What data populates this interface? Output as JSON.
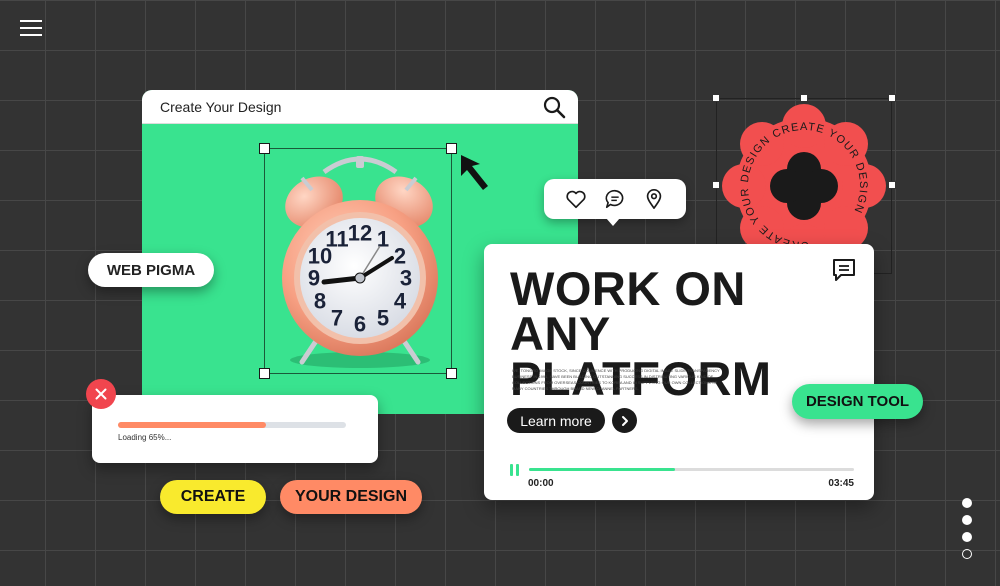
{
  "design_window": {
    "title": "Create Your Design"
  },
  "stamp": {
    "ring_text": "CREATE YOUR DESIGN CREATE YOUR DESIGN "
  },
  "clock": {
    "numbers": [
      "12",
      "1",
      "2",
      "3",
      "4",
      "5",
      "6",
      "7",
      "8",
      "9",
      "10",
      "11"
    ]
  },
  "pills": {
    "web_pigma": "WEB PIGMA",
    "design_tool": "DESIGN TOOL",
    "create": "CREATE",
    "your_design": "YOUR DESIGN"
  },
  "loading": {
    "progress": 0.65,
    "text": "Loading 65%..."
  },
  "main_card": {
    "headline_line1": "WORK ON",
    "headline_line2": "ANY PLATFORM",
    "body_text": "WE, TONGRO IMAGE STOCK, SINCE COMMENCE WITH PRODUCING DIGITAL IMAGE SLIDE TRANSPARENCY BUSINESS IN 1991, HAVE BEEN BUILDING OUTSTANDING SUCCESS IN DISTRIBUTING VARIOUS KIND OF COLLECTIONS FROM OVERSEAS COUNTRIES TO KOREA AND IN SUPPLYING OUR OWN COLLECTIONS TO MANY COUNTRIES THROUGH BRAND NEW CHANNEL PARTNERS.",
    "learn_more": "Learn more",
    "video_progress": 0.45,
    "time_start": "00:00",
    "time_end": "03:45"
  },
  "pagination": {
    "active_pages": 3,
    "total_pages": 4
  },
  "colors": {
    "green": "#39e38f",
    "coral": "#ff8a65",
    "yellow": "#f9ea2d",
    "red": "#f1454e",
    "stamp_red": "#f24f4f",
    "background": "#333333"
  }
}
